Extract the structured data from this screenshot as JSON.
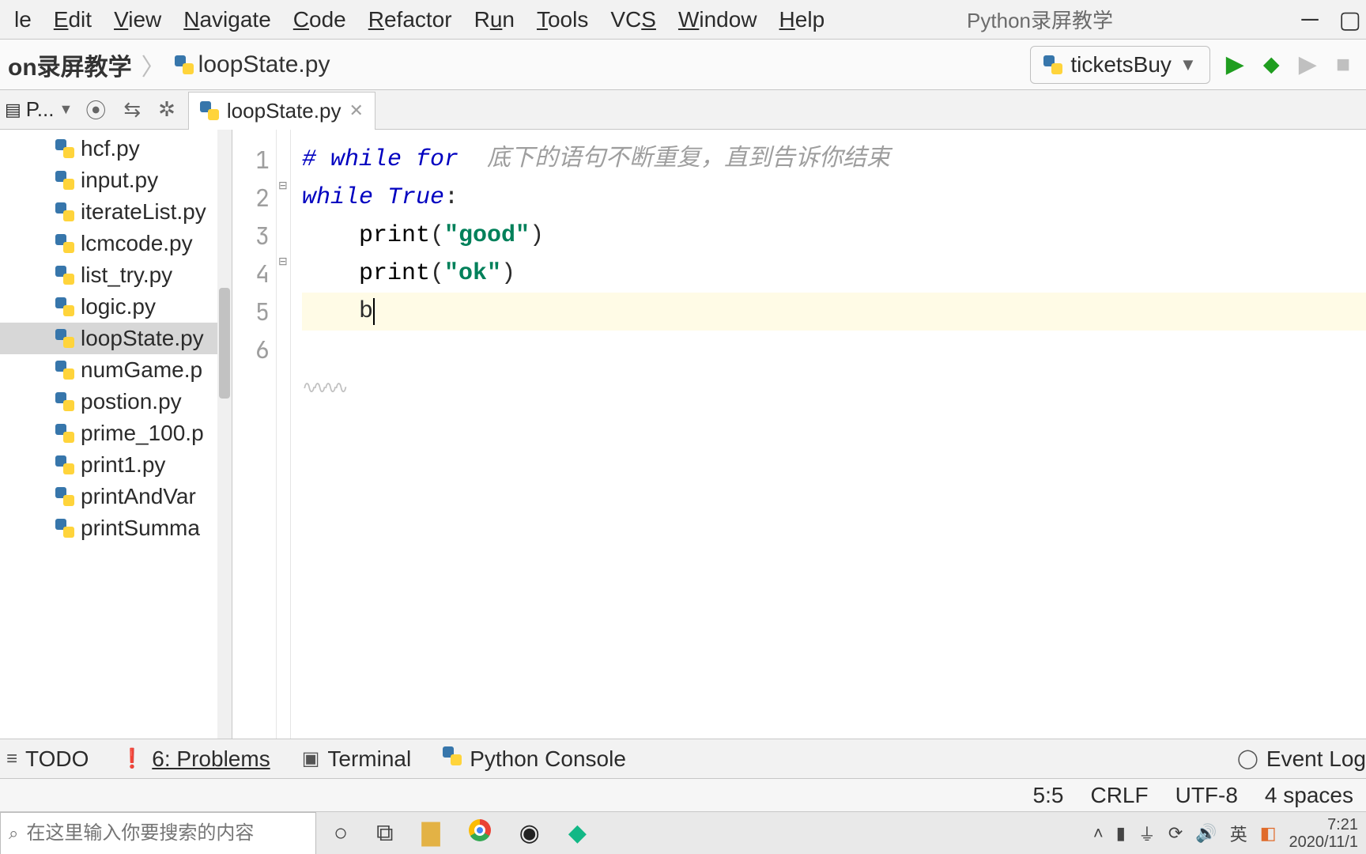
{
  "menu": {
    "items": [
      {
        "label": "le",
        "u": ""
      },
      {
        "label": "Edit",
        "u": "E"
      },
      {
        "label": "View",
        "u": "V"
      },
      {
        "label": "Navigate",
        "u": "N"
      },
      {
        "label": "Code",
        "u": "C"
      },
      {
        "label": "Refactor",
        "u": "R"
      },
      {
        "label": "Run",
        "u": "R"
      },
      {
        "label": "Tools",
        "u": "T"
      },
      {
        "label": "VCS",
        "u": "S"
      },
      {
        "label": "Window",
        "u": "W"
      },
      {
        "label": "Help",
        "u": "H"
      }
    ],
    "title_right": "Python录屏教学"
  },
  "breadcrumb": {
    "project": "on录屏教学",
    "file": "loopState.py"
  },
  "run_config": "ticketsBuy",
  "project_btn": "P...",
  "tab": {
    "name": "loopState.py"
  },
  "tree": {
    "items": [
      {
        "label": "hcf.py"
      },
      {
        "label": "input.py"
      },
      {
        "label": "iterateList.py"
      },
      {
        "label": "lcmcode.py"
      },
      {
        "label": "list_try.py"
      },
      {
        "label": "logic.py"
      },
      {
        "label": "loopState.py",
        "selected": true
      },
      {
        "label": "numGame.p"
      },
      {
        "label": "postion.py"
      },
      {
        "label": "prime_100.p"
      },
      {
        "label": "print1.py"
      },
      {
        "label": "printAndVar"
      },
      {
        "label": "printSumma"
      }
    ]
  },
  "code": {
    "lines": [
      1,
      2,
      3,
      4,
      5,
      6
    ],
    "l1_kw": "# while for",
    "l1_rest": "  底下的语句不断重复，直到告诉你结束",
    "l2_kw": "while ",
    "l2_true": "True",
    "l2_colon": ":",
    "l3": "print",
    "l3_open": "(",
    "l3_str": "\"good\"",
    "l3_close": ")",
    "l4": "print",
    "l4_open": "(",
    "l4_str": "\"ok\"",
    "l4_close": ")",
    "l5": "b"
  },
  "toolwindow": {
    "todo": "TODO",
    "problems": "6: Problems",
    "terminal": "Terminal",
    "pyconsole": "Python Console",
    "eventlog": "Event Log"
  },
  "status": {
    "pos": "5:5",
    "eol": "CRLF",
    "enc": "UTF-8",
    "indent": "4 spaces"
  },
  "taskbar": {
    "search_placeholder": "在这里输入你要搜索的内容",
    "ime": "英",
    "time": "7:21",
    "date": "2020/11/1"
  }
}
